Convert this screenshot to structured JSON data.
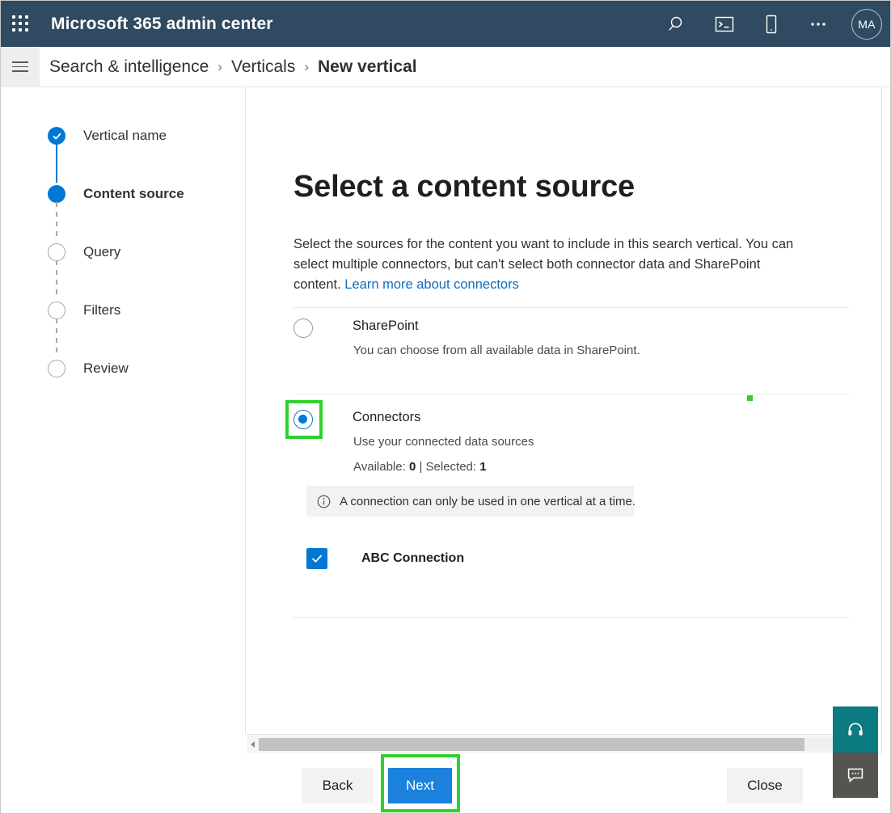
{
  "suite_header": {
    "waffle_icon": "app-launcher-waffle-icon",
    "title": "Microsoft 365 admin center",
    "actions": [
      {
        "name": "search-icon",
        "label": "Search"
      },
      {
        "name": "console-icon",
        "label": "Open console"
      },
      {
        "name": "mobile-icon",
        "label": "Mobile"
      },
      {
        "name": "more-icon",
        "label": "More"
      }
    ],
    "avatar_initials": "MA",
    "background_color": "#2f4a61"
  },
  "breadcrumb": {
    "menu_icon": "hamburger-icon",
    "items": [
      {
        "label": "Search & intelligence",
        "current": false
      },
      {
        "label": "Verticals",
        "current": false
      },
      {
        "label": "New vertical",
        "current": true
      }
    ],
    "separator": "›"
  },
  "wizard": {
    "steps": [
      {
        "label": "Vertical name",
        "state": "done"
      },
      {
        "label": "Content source",
        "state": "current"
      },
      {
        "label": "Query",
        "state": "todo"
      },
      {
        "label": "Filters",
        "state": "todo"
      },
      {
        "label": "Review",
        "state": "todo"
      }
    ],
    "accent_color": "#0078d4"
  },
  "main": {
    "title": "Select a content source",
    "description_part1": "Select the sources for the content you want to include in this search vertical. You can select multiple connectors, but can't select both connector data and SharePoint content. ",
    "description_link": "Learn more about connectors",
    "options": [
      {
        "id": "sharepoint",
        "title": "SharePoint",
        "subtitle": "You can choose from all available data in SharePoint.",
        "selected": false
      },
      {
        "id": "connectors",
        "title": "Connectors",
        "subtitle": "Use your connected data sources",
        "selected": true,
        "counts_prefix": "Available: ",
        "available": "0",
        "counts_middle": " | Selected: ",
        "selected_count": "1"
      }
    ],
    "info_message": {
      "icon": "info-circle-icon",
      "text": "A connection can only be used in one vertical at a time."
    },
    "connection": {
      "checkbox_icon": "checkmark-icon",
      "checked": true,
      "label": "ABC Connection"
    }
  },
  "scrollbar": {
    "left_arrow_icon": "chevron-left-icon",
    "orientation": "horizontal"
  },
  "footer": {
    "back_label": "Back",
    "next_label": "Next",
    "close_label": "Close",
    "primary_color": "#1b81dd"
  },
  "side_buttons": [
    {
      "name": "help-support-button",
      "icon": "headset-icon",
      "color": "#0b7b81"
    },
    {
      "name": "feedback-button",
      "icon": "chat-icon",
      "color": "#56544f"
    }
  ],
  "annotations": {
    "highlight_color": "#2fd02f",
    "items": [
      {
        "name": "connectors-radio-highlight"
      },
      {
        "name": "next-button-highlight"
      },
      {
        "name": "green-dot-marker"
      }
    ]
  }
}
